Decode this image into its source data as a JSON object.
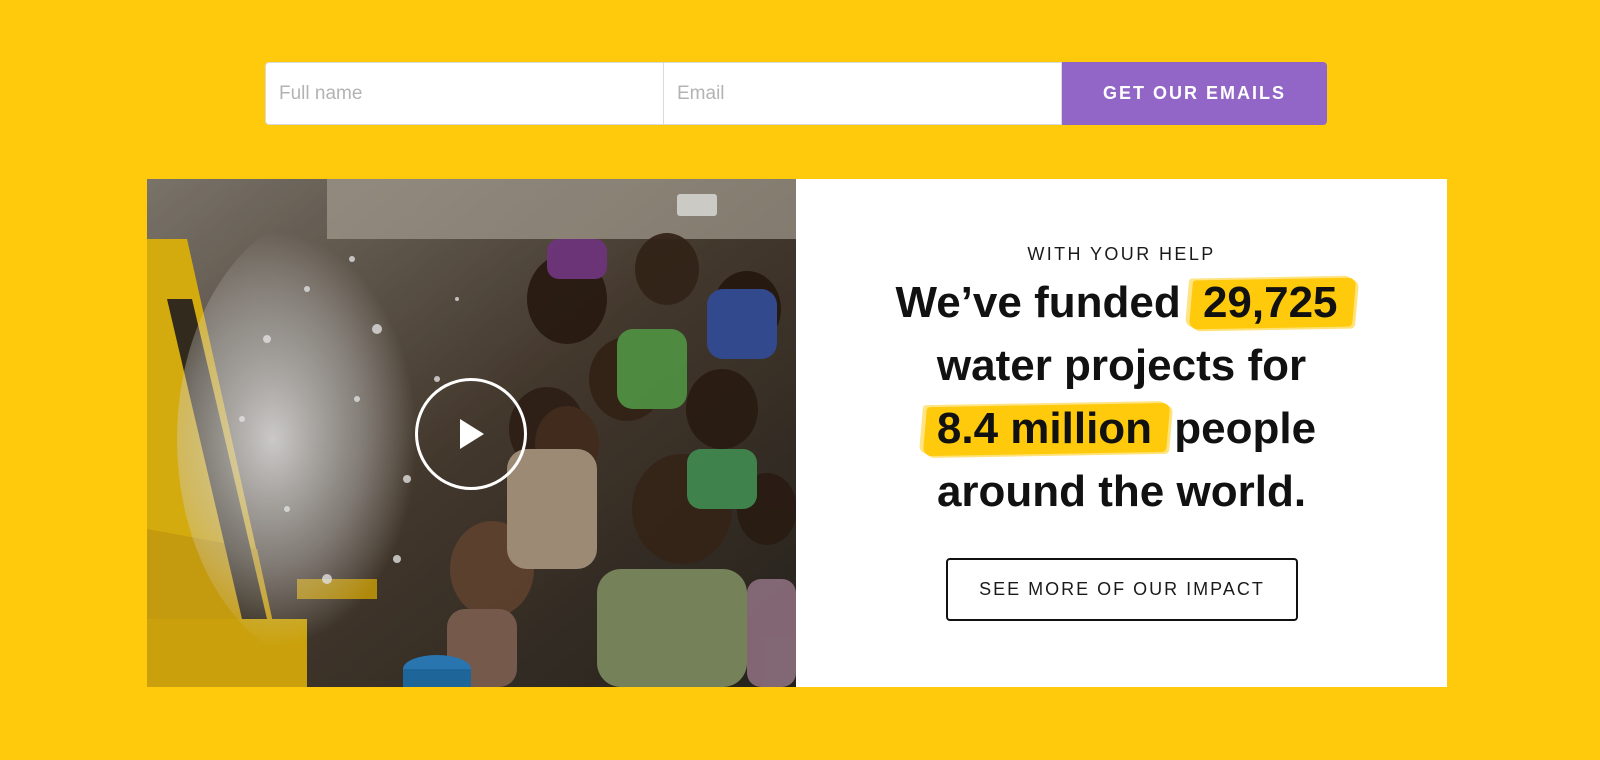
{
  "colors": {
    "page_background": "#FFCA0B",
    "button_accent": "#9266C7",
    "highlight": "#FFCA0B"
  },
  "signup": {
    "name_placeholder": "Full name",
    "email_placeholder": "Email",
    "button_label": "GET OUR EMAILS"
  },
  "impact": {
    "video": {
      "image_description": "Crowd of smiling children reaching toward water spraying from a yellow drilling rig",
      "play_icon": "play-icon"
    },
    "eyebrow": "WITH YOUR HELP",
    "headline": {
      "line1_prefix": "We’ve funded",
      "projects_count": "29,725",
      "line2": "water projects for",
      "people_count": "8.4 million",
      "line3_suffix": "people",
      "line4": "around the world."
    },
    "cta_label": "SEE MORE OF OUR IMPACT"
  }
}
